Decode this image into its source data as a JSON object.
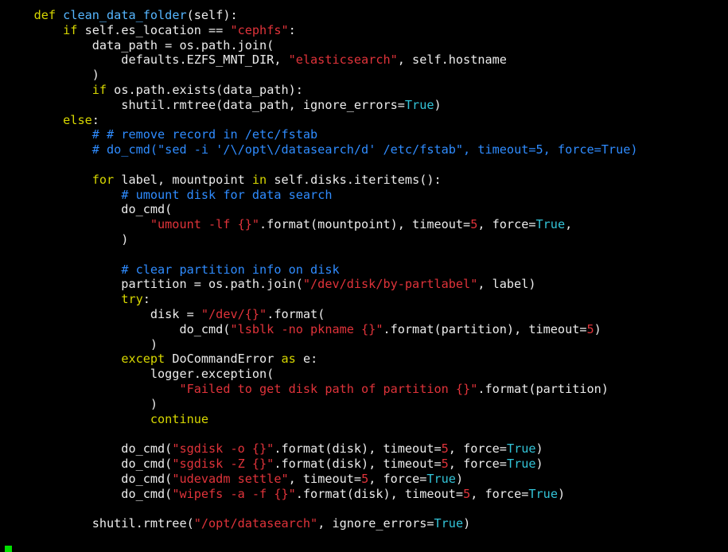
{
  "terminal": {
    "colors": {
      "background": "#000000",
      "keyword": "#d7d700",
      "function_name": "#56b6ff",
      "string": "#e0333a",
      "comment": "#2f8cff",
      "number": "#e0333a",
      "boolean": "#33c4d8",
      "text": "#ececec",
      "cursor": "#00e000"
    },
    "lines": [
      [
        [
          "    ",
          "plain"
        ],
        [
          "def",
          "kw"
        ],
        [
          " ",
          "plain"
        ],
        [
          "clean_data_folder",
          "fn"
        ],
        [
          "(self):",
          "plain"
        ]
      ],
      [
        [
          "        ",
          "plain"
        ],
        [
          "if",
          "kw"
        ],
        [
          " self.es_location == ",
          "plain"
        ],
        [
          "\"cephfs\"",
          "str"
        ],
        [
          ":",
          "plain"
        ]
      ],
      [
        [
          "            data_path = os.path.join(",
          "plain"
        ]
      ],
      [
        [
          "                defaults.EZFS_MNT_DIR, ",
          "plain"
        ],
        [
          "\"elasticsearch\"",
          "str"
        ],
        [
          ", self.hostname",
          "plain"
        ]
      ],
      [
        [
          "            )",
          "plain"
        ]
      ],
      [
        [
          "            ",
          "plain"
        ],
        [
          "if",
          "kw"
        ],
        [
          " os.path.exists(data_path):",
          "plain"
        ]
      ],
      [
        [
          "                shutil.rmtree(data_path, ignore_errors=",
          "plain"
        ],
        [
          "True",
          "bool"
        ],
        [
          ")",
          "plain"
        ]
      ],
      [
        [
          "        ",
          "plain"
        ],
        [
          "else",
          "kw"
        ],
        [
          ":",
          "plain"
        ]
      ],
      [
        [
          "            ",
          "plain"
        ],
        [
          "# # remove record in /etc/fstab",
          "com"
        ]
      ],
      [
        [
          "            ",
          "plain"
        ],
        [
          "# do_cmd(\"sed -i '/\\/opt\\/datasearch/d' /etc/fstab\", timeout=5, force=True)",
          "com"
        ]
      ],
      [
        [
          "",
          "plain"
        ]
      ],
      [
        [
          "            ",
          "plain"
        ],
        [
          "for",
          "kw"
        ],
        [
          " label, mountpoint ",
          "plain"
        ],
        [
          "in",
          "kw"
        ],
        [
          " self.disks.iteritems():",
          "plain"
        ]
      ],
      [
        [
          "                ",
          "plain"
        ],
        [
          "# umount disk for data search",
          "com"
        ]
      ],
      [
        [
          "                do_cmd(",
          "plain"
        ]
      ],
      [
        [
          "                    ",
          "plain"
        ],
        [
          "\"umount -lf {}\"",
          "str"
        ],
        [
          ".format(mountpoint), timeout=",
          "plain"
        ],
        [
          "5",
          "num"
        ],
        [
          ", force=",
          "plain"
        ],
        [
          "True",
          "bool"
        ],
        [
          ",",
          "plain"
        ]
      ],
      [
        [
          "                )",
          "plain"
        ]
      ],
      [
        [
          "",
          "plain"
        ]
      ],
      [
        [
          "                ",
          "plain"
        ],
        [
          "# clear partition info on disk",
          "com"
        ]
      ],
      [
        [
          "                partition = os.path.join(",
          "plain"
        ],
        [
          "\"/dev/disk/by-partlabel\"",
          "str"
        ],
        [
          ", label)",
          "plain"
        ]
      ],
      [
        [
          "                ",
          "plain"
        ],
        [
          "try",
          "kw"
        ],
        [
          ":",
          "plain"
        ]
      ],
      [
        [
          "                    disk = ",
          "plain"
        ],
        [
          "\"/dev/{}\"",
          "str"
        ],
        [
          ".format(",
          "plain"
        ]
      ],
      [
        [
          "                        do_cmd(",
          "plain"
        ],
        [
          "\"lsblk -no pkname {}\"",
          "str"
        ],
        [
          ".format(partition), timeout=",
          "plain"
        ],
        [
          "5",
          "num"
        ],
        [
          ")",
          "plain"
        ]
      ],
      [
        [
          "                    )",
          "plain"
        ]
      ],
      [
        [
          "                ",
          "plain"
        ],
        [
          "except",
          "kw"
        ],
        [
          " DoCommandError ",
          "plain"
        ],
        [
          "as",
          "kw"
        ],
        [
          " e:",
          "plain"
        ]
      ],
      [
        [
          "                    logger.exception(",
          "plain"
        ]
      ],
      [
        [
          "                        ",
          "plain"
        ],
        [
          "\"Failed to get disk path of partition {}\"",
          "str"
        ],
        [
          ".format(partition)",
          "plain"
        ]
      ],
      [
        [
          "                    )",
          "plain"
        ]
      ],
      [
        [
          "                    ",
          "plain"
        ],
        [
          "continue",
          "kw"
        ]
      ],
      [
        [
          "",
          "plain"
        ]
      ],
      [
        [
          "                do_cmd(",
          "plain"
        ],
        [
          "\"sgdisk -o {}\"",
          "str"
        ],
        [
          ".format(disk), timeout=",
          "plain"
        ],
        [
          "5",
          "num"
        ],
        [
          ", force=",
          "plain"
        ],
        [
          "True",
          "bool"
        ],
        [
          ")",
          "plain"
        ]
      ],
      [
        [
          "                do_cmd(",
          "plain"
        ],
        [
          "\"sgdisk -Z {}\"",
          "str"
        ],
        [
          ".format(disk), timeout=",
          "plain"
        ],
        [
          "5",
          "num"
        ],
        [
          ", force=",
          "plain"
        ],
        [
          "True",
          "bool"
        ],
        [
          ")",
          "plain"
        ]
      ],
      [
        [
          "                do_cmd(",
          "plain"
        ],
        [
          "\"udevadm settle\"",
          "str"
        ],
        [
          ", timeout=",
          "plain"
        ],
        [
          "5",
          "num"
        ],
        [
          ", force=",
          "plain"
        ],
        [
          "True",
          "bool"
        ],
        [
          ")",
          "plain"
        ]
      ],
      [
        [
          "                do_cmd(",
          "plain"
        ],
        [
          "\"wipefs -a -f {}\"",
          "str"
        ],
        [
          ".format(disk), timeout=",
          "plain"
        ],
        [
          "5",
          "num"
        ],
        [
          ", force=",
          "plain"
        ],
        [
          "True",
          "bool"
        ],
        [
          ")",
          "plain"
        ]
      ],
      [
        [
          "",
          "plain"
        ]
      ],
      [
        [
          "            shutil.rmtree(",
          "plain"
        ],
        [
          "\"/opt/datasearch\"",
          "str"
        ],
        [
          ", ignore_errors=",
          "plain"
        ],
        [
          "True",
          "bool"
        ],
        [
          ")",
          "plain"
        ]
      ]
    ]
  }
}
